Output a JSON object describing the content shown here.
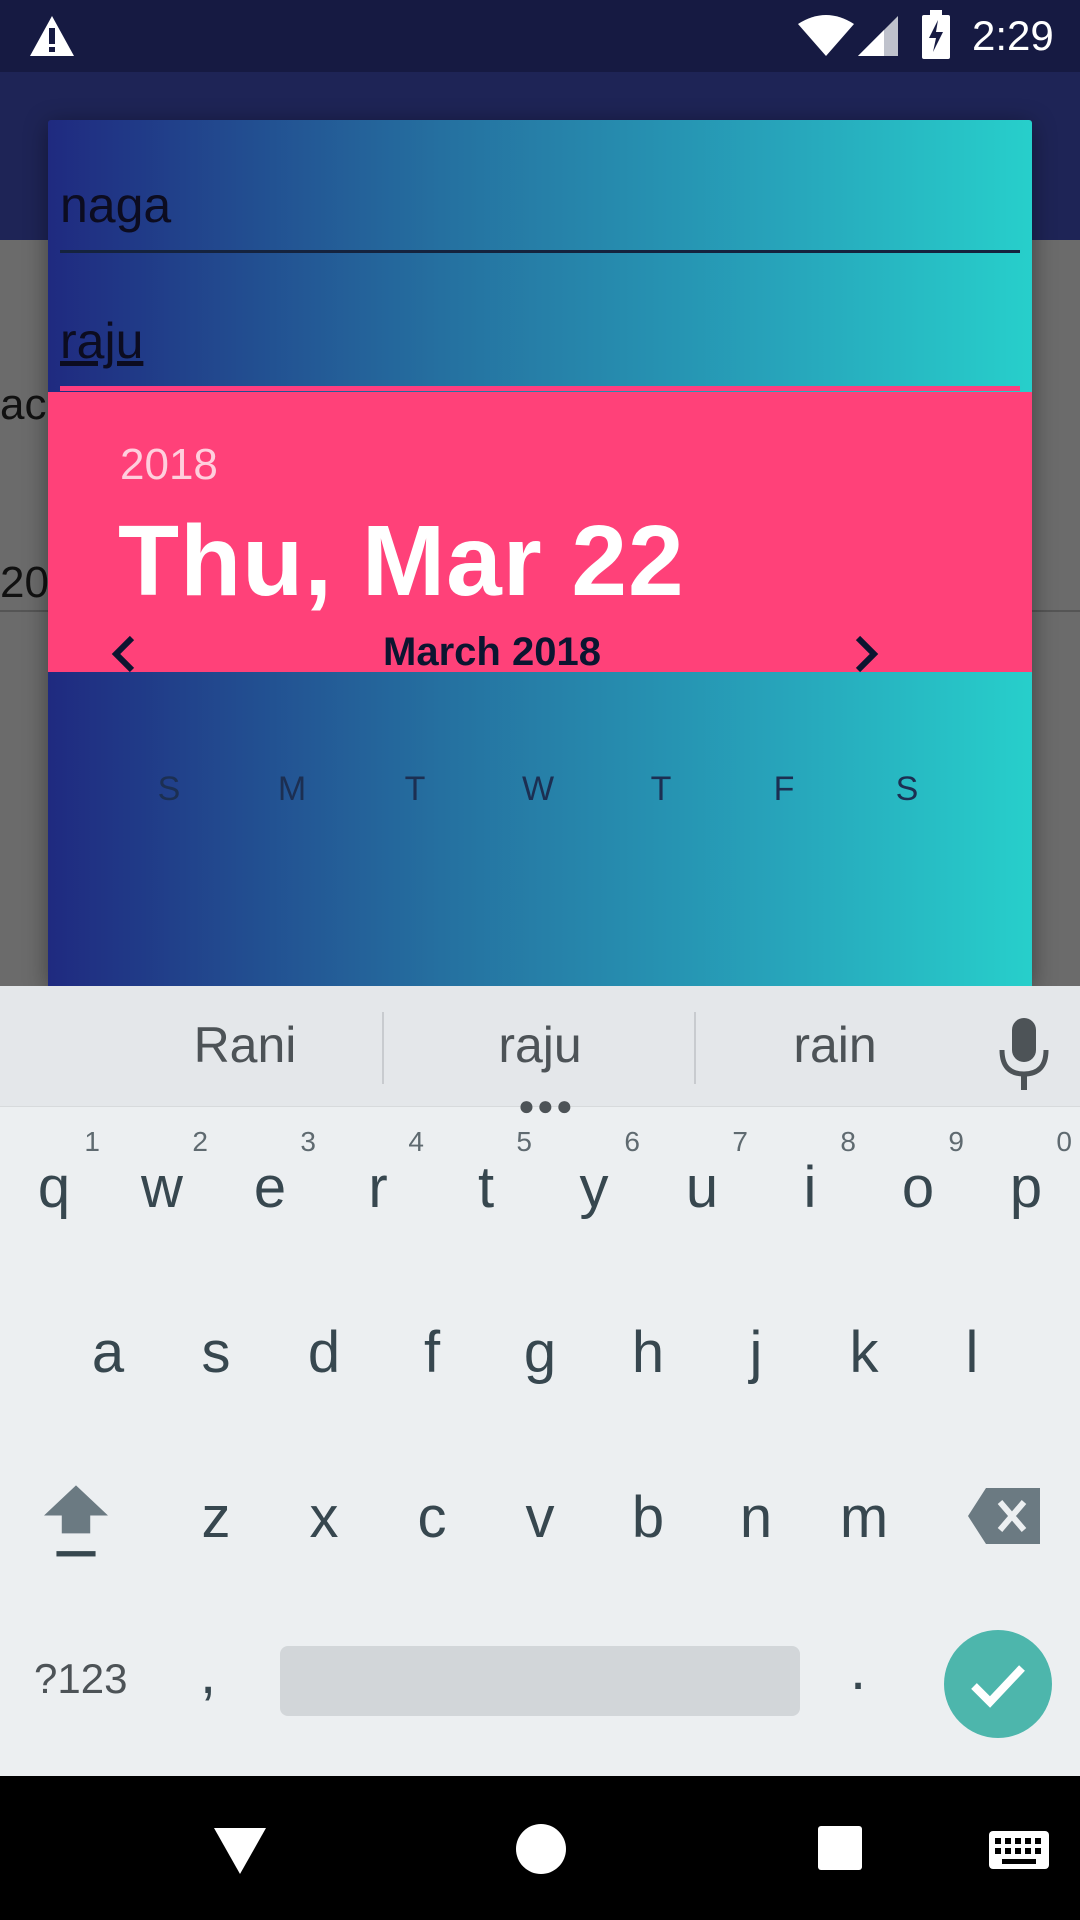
{
  "status_bar": {
    "time": "2:29",
    "icons": [
      "warning-icon",
      "wifi-icon",
      "signal-icon",
      "battery-charging-icon"
    ]
  },
  "background": {
    "text1": "ac",
    "text2": "20"
  },
  "dialog": {
    "field1_value": "naga",
    "field2_value": "raju",
    "header": {
      "year": "2018",
      "date": "Thu, Mar 22"
    },
    "month_label": "March 2018",
    "weekdays": [
      "S",
      "M",
      "T",
      "W",
      "T",
      "F",
      "S"
    ]
  },
  "keyboard": {
    "suggestions": [
      "Rani",
      "raju",
      "rain"
    ],
    "row1": [
      {
        "key": "q",
        "hint": "1"
      },
      {
        "key": "w",
        "hint": "2"
      },
      {
        "key": "e",
        "hint": "3"
      },
      {
        "key": "r",
        "hint": "4"
      },
      {
        "key": "t",
        "hint": "5"
      },
      {
        "key": "y",
        "hint": "6"
      },
      {
        "key": "u",
        "hint": "7"
      },
      {
        "key": "i",
        "hint": "8"
      },
      {
        "key": "o",
        "hint": "9"
      },
      {
        "key": "p",
        "hint": "0"
      }
    ],
    "row2": [
      "a",
      "s",
      "d",
      "f",
      "g",
      "h",
      "j",
      "k",
      "l"
    ],
    "row3": [
      "z",
      "x",
      "c",
      "v",
      "b",
      "n",
      "m"
    ],
    "symbols_label": "?123",
    "comma_label": ",",
    "period_label": ".",
    "accent_color": "#4db6ac"
  },
  "colors": {
    "header": "#ff4179",
    "status_bar": "#161a42",
    "underline_active": "#ff3d7f"
  }
}
